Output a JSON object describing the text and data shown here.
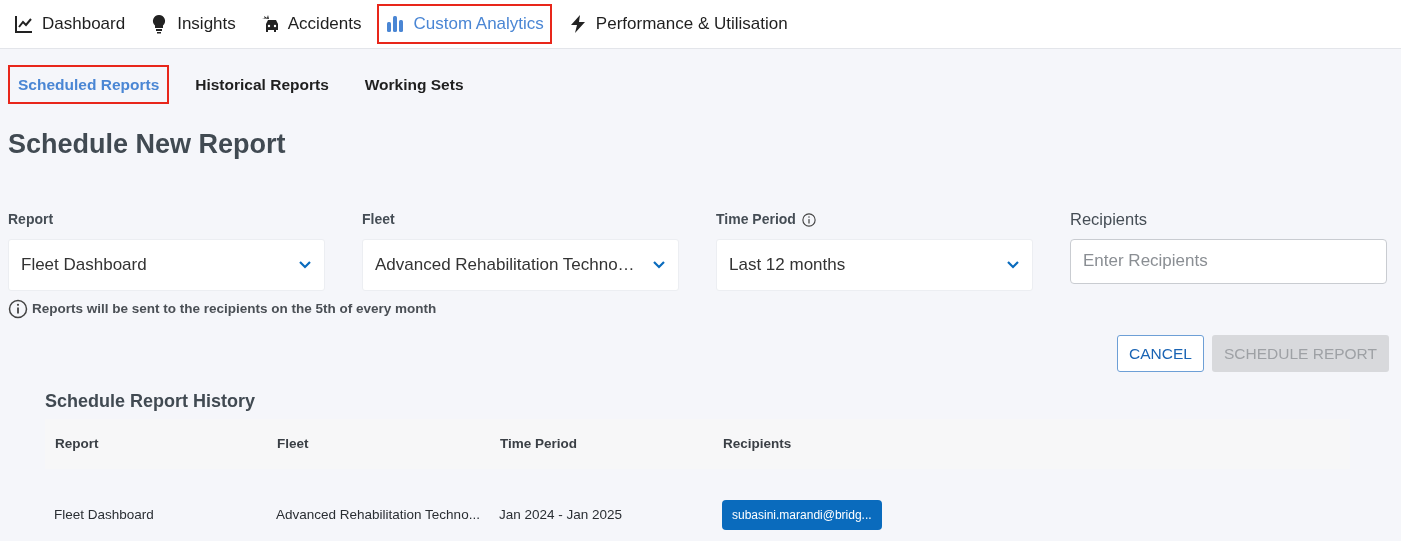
{
  "nav_tabs": [
    {
      "label": "Dashboard",
      "selected": false
    },
    {
      "label": "Insights",
      "selected": false
    },
    {
      "label": "Accidents",
      "selected": false
    },
    {
      "label": "Custom Analytics",
      "selected": true
    },
    {
      "label": "Performance & Utilisation",
      "selected": false
    }
  ],
  "sub_tabs": [
    {
      "label": "Scheduled Reports",
      "selected": true
    },
    {
      "label": "Historical Reports",
      "selected": false
    },
    {
      "label": "Working Sets",
      "selected": false
    }
  ],
  "page_title": "Schedule New Report",
  "form": {
    "fields": [
      {
        "kind": "select",
        "label": "Report",
        "value": "Fleet Dashboard"
      },
      {
        "kind": "select",
        "label": "Fleet",
        "value": "Advanced Rehabilitation Techno…"
      },
      {
        "kind": "select",
        "label": "Time Period",
        "info": true,
        "value": "Last 12 months"
      },
      {
        "kind": "text",
        "label": "Recipients",
        "placeholder": "Enter Recipients"
      }
    ],
    "note": "Reports will be sent to the recipients on the 5th of every month",
    "buttons": [
      {
        "label": "CANCEL",
        "disabled": false
      },
      {
        "label": "SCHEDULE REPORT",
        "disabled": true
      }
    ]
  },
  "history": {
    "title": "Schedule Report History",
    "columns": [
      "Report",
      "Fleet",
      "Time Period",
      "Recipients"
    ],
    "rows": [
      {
        "report": "Fleet Dashboard",
        "fleet": "Advanced Rehabilitation Techno...",
        "time_period": "Jan 2024 - Jan 2025",
        "recipients": [
          "subasini.marandi@bridg..."
        ]
      }
    ]
  }
}
